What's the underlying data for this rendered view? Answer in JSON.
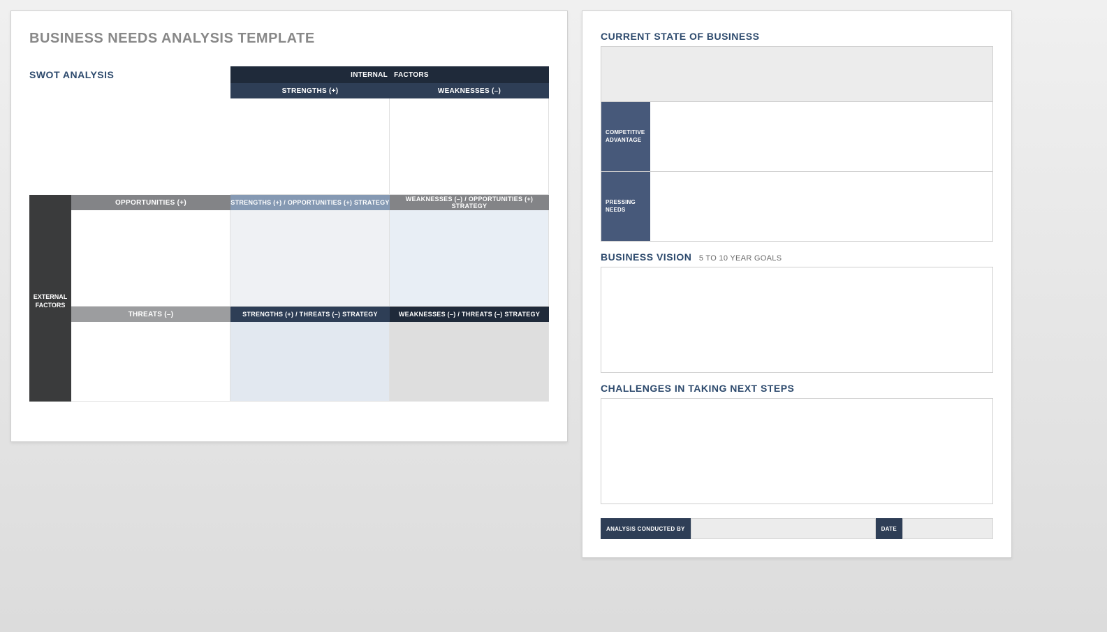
{
  "left": {
    "title": "BUSINESS NEEDS ANALYSIS TEMPLATE",
    "swot_heading": "SWOT ANALYSIS",
    "internal_factors": "INTERNAL   FACTORS",
    "strengths": "STRENGTHS (+)",
    "weaknesses": "WEAKNESSES (–)",
    "external_factors": "EXTERNAL FACTORS",
    "opportunities": "OPPORTUNITIES (+)",
    "threats": "THREATS (–)",
    "so_strategy": "STRENGTHS (+) / OPPORTUNITIES (+) STRATEGY",
    "wo_strategy": "WEAKNESSES (–) / OPPORTUNITIES (+) STRATEGY",
    "st_strategy": "STRENGTHS (+) / THREATS (–) STRATEGY",
    "wt_strategy": "WEAKNESSES (–) / THREATS (–) STRATEGY"
  },
  "right": {
    "current_state": "CURRENT STATE OF BUSINESS",
    "competitive_advantage": "COMPETITIVE ADVANTAGE",
    "pressing_needs": "PRESSING NEEDS",
    "business_vision": "BUSINESS VISION",
    "vision_sub": "5 TO 10 YEAR GOALS",
    "challenges": "CHALLENGES IN TAKING NEXT STEPS",
    "analysis_conducted_by": "ANALYSIS CONDUCTED BY",
    "date": "DATE"
  }
}
